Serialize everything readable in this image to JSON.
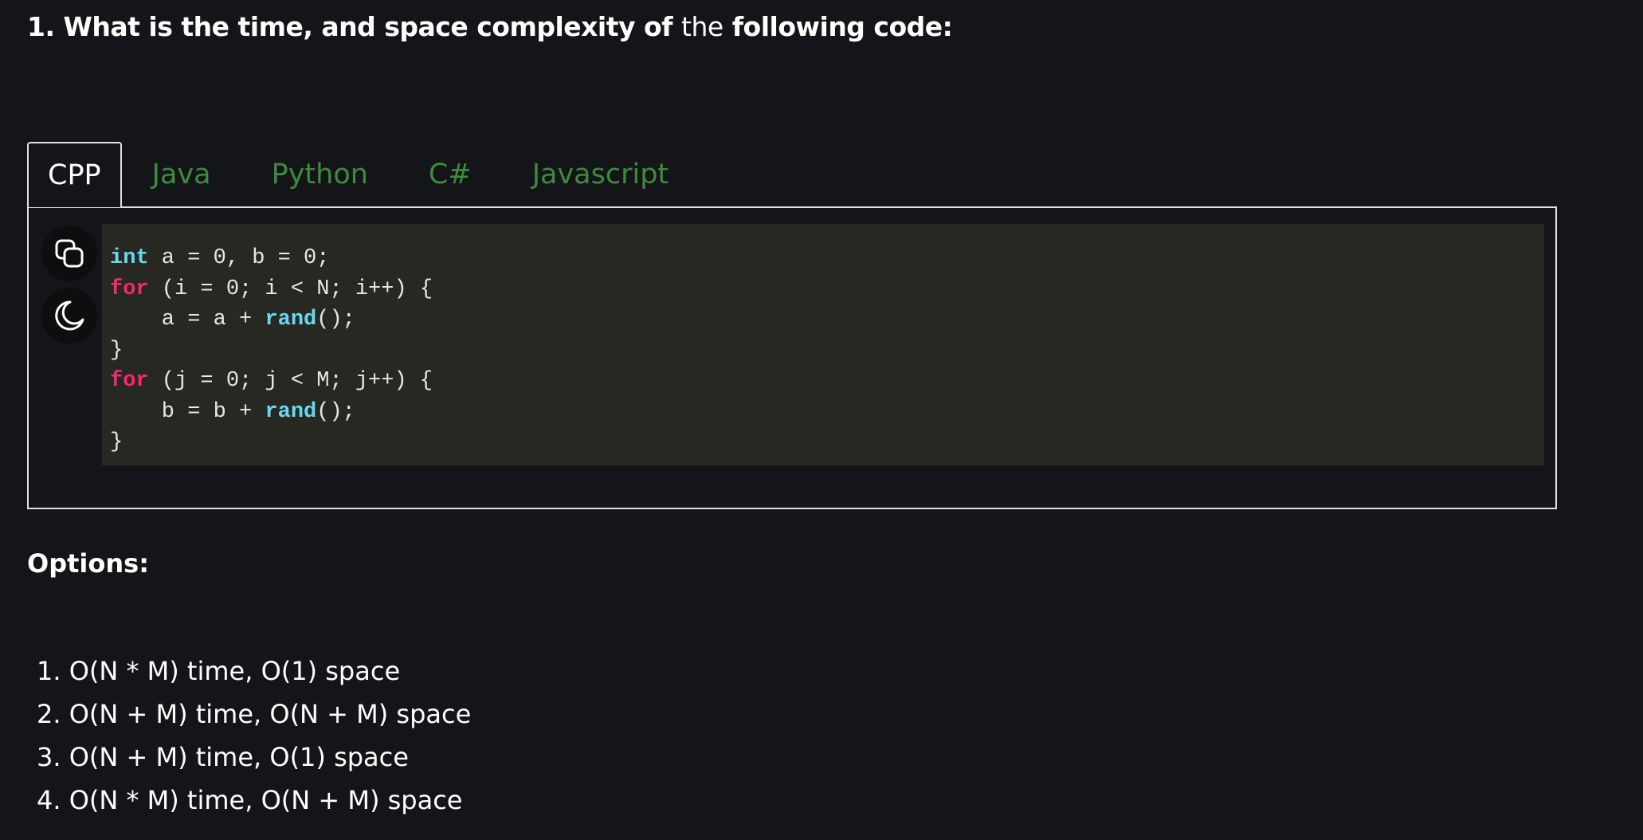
{
  "question": {
    "part1": "1. What is the time, and space complexity of ",
    "part2": "the",
    "part3": " following code:"
  },
  "tabs": [
    {
      "label": "CPP",
      "active": true
    },
    {
      "label": "Java",
      "active": false
    },
    {
      "label": "Python",
      "active": false
    },
    {
      "label": "C#",
      "active": false
    },
    {
      "label": "Javascript",
      "active": false
    }
  ],
  "code": {
    "language": "cpp",
    "lines": [
      "int a = 0, b = 0;",
      "for (i = 0; i < N; i++) {",
      "    a = a + rand();",
      "}",
      "for (j = 0; j < M; j++) {",
      "    b = b + rand();",
      "}"
    ],
    "tokens": {
      "int": "int",
      "a_decl": " a = 0, b = 0;",
      "for1": "for",
      "loop1": " (i = 0; i < N; i++) {",
      "body1_pre": "    a = a + ",
      "rand1": "rand",
      "body1_post": "();",
      "close1": "}",
      "for2": "for",
      "loop2": " (j = 0; j < M; j++) {",
      "body2_pre": "    b = b + ",
      "rand2": "rand",
      "body2_post": "();",
      "close2": "}"
    }
  },
  "toolbar": {
    "copy_icon": "copy-icon",
    "theme_icon": "moon-icon"
  },
  "options": {
    "title": "Options:",
    "items": [
      "1. O(N * M) time, O(1) space",
      "2. O(N + M) time, O(N + M) space",
      "3. O(N + M) time, O(1) space",
      "4. O(N * M) time, O(N + M) space"
    ]
  },
  "colors": {
    "background": "#131519",
    "code_background": "#272822",
    "tab_inactive": "#3d8b3d",
    "keyword_type": "#66d9ef",
    "keyword_control": "#f92672"
  }
}
